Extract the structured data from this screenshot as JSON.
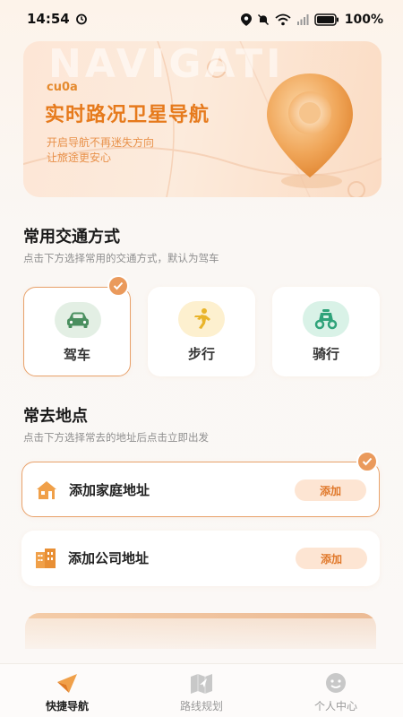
{
  "status_bar": {
    "time": "14:54",
    "battery": "100%"
  },
  "banner": {
    "watermark": "NAVIGATI",
    "tag": "cu0a",
    "title": "实时路况卫星导航",
    "subtitle_line1": "开启导航不再迷失方向",
    "subtitle_line2": "让旅途更安心"
  },
  "transport": {
    "title": "常用交通方式",
    "description": "点击下方选择常用的交通方式，默认为驾车",
    "options": [
      {
        "label": "驾车",
        "icon": "car-icon",
        "selected": true
      },
      {
        "label": "步行",
        "icon": "walking-icon",
        "selected": false
      },
      {
        "label": "骑行",
        "icon": "scooter-icon",
        "selected": false
      }
    ]
  },
  "places": {
    "title": "常去地点",
    "description": "点击下方选择常去的地址后点击立即出发",
    "items": [
      {
        "label": "添加家庭地址",
        "button": "添加",
        "icon": "home-icon",
        "selected": true
      },
      {
        "label": "添加公司地址",
        "button": "添加",
        "icon": "office-building-icon",
        "selected": false
      }
    ]
  },
  "tabbar": {
    "tabs": [
      {
        "label": "快捷导航",
        "icon": "navigation-arrow-icon",
        "active": true
      },
      {
        "label": "路线规划",
        "icon": "map-route-icon",
        "active": false
      },
      {
        "label": "个人中心",
        "icon": "smiley-user-icon",
        "active": false
      }
    ]
  },
  "colors": {
    "accent": "#E8893A",
    "accent_light": "#FDE5D3",
    "text_primary": "#222222",
    "text_secondary": "#8F8F8F"
  }
}
